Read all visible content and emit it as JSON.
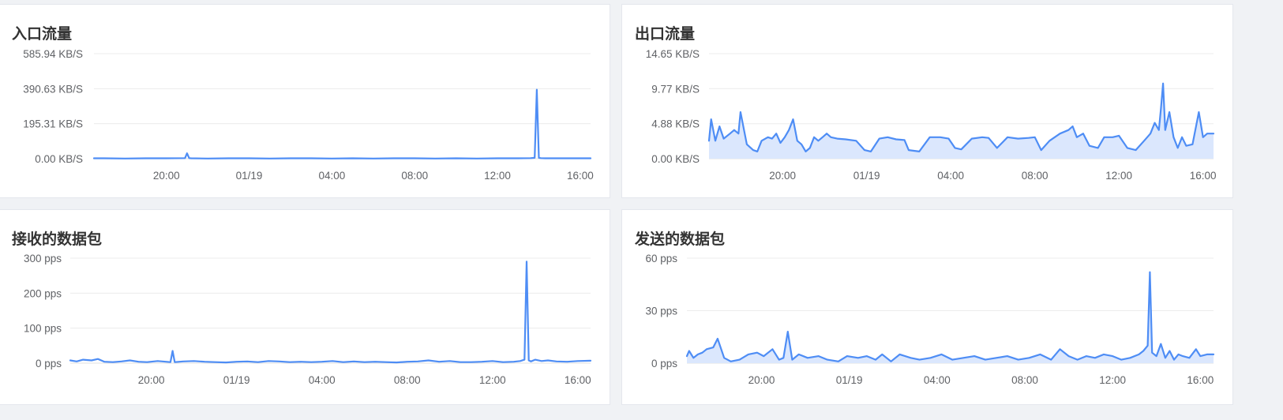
{
  "colors": {
    "line": "#4e8df5",
    "area": "#dbe7fd",
    "grid": "#ececec",
    "text": "#606266"
  },
  "chart_data": [
    {
      "type": "line",
      "title": "入口流量",
      "ylabel": "",
      "xlabel": "",
      "ylim": [
        0,
        585.94
      ],
      "yticks": [
        "585.94 KB/S",
        "390.63 KB/S",
        "195.31 KB/S",
        "0.00 KB/S"
      ],
      "ytick_values": [
        585.94,
        390.63,
        195.31,
        0
      ],
      "xlim_hours": [
        16.5,
        40.5
      ],
      "xticks": [
        "20:00",
        "01/19",
        "04:00",
        "08:00",
        "12:00",
        "16:00"
      ],
      "xtick_hours": [
        20,
        24,
        28,
        32,
        36,
        40
      ],
      "area": false,
      "series": [
        {
          "x": [
            16.5,
            17,
            18,
            19,
            20,
            20.9,
            21.0,
            21.1,
            21.2,
            22,
            23,
            24,
            25,
            26,
            27,
            28,
            29,
            30,
            31,
            32,
            33,
            34,
            35,
            36,
            37,
            37.6,
            37.8,
            37.9,
            38.0,
            38.1,
            38.3,
            39,
            40,
            40.5
          ],
          "y": [
            2,
            2,
            1,
            2,
            2,
            3,
            30,
            3,
            2,
            1,
            2,
            2,
            1,
            2,
            2,
            1,
            2,
            1,
            2,
            2,
            1,
            2,
            1,
            2,
            2,
            3,
            5,
            385,
            5,
            3,
            2,
            2,
            2,
            2
          ]
        }
      ]
    },
    {
      "type": "area",
      "title": "出口流量",
      "ylabel": "",
      "xlabel": "",
      "ylim": [
        0,
        14.65
      ],
      "yticks": [
        "14.65 KB/S",
        "9.77 KB/S",
        "4.88 KB/S",
        "0.00 KB/S"
      ],
      "ytick_values": [
        14.65,
        9.77,
        4.88,
        0
      ],
      "xlim_hours": [
        16.5,
        40.5
      ],
      "xticks": [
        "20:00",
        "01/19",
        "04:00",
        "08:00",
        "12:00",
        "16:00"
      ],
      "xtick_hours": [
        20,
        24,
        28,
        32,
        36,
        40
      ],
      "area": true,
      "series": [
        {
          "x": [
            16.5,
            16.6,
            16.8,
            17.0,
            17.2,
            17.5,
            17.7,
            17.9,
            18.0,
            18.3,
            18.6,
            18.8,
            19.0,
            19.3,
            19.5,
            19.7,
            19.9,
            20.1,
            20.3,
            20.5,
            20.7,
            20.9,
            21.1,
            21.3,
            21.5,
            21.7,
            21.9,
            22.1,
            22.3,
            22.6,
            23,
            23.5,
            23.9,
            24.2,
            24.6,
            25.0,
            25.4,
            25.8,
            26.0,
            26.5,
            27.0,
            27.5,
            27.9,
            28.2,
            28.5,
            29.0,
            29.5,
            29.8,
            30.2,
            30.7,
            31.2,
            31.7,
            32.0,
            32.3,
            32.7,
            33.2,
            33.6,
            33.8,
            34.0,
            34.3,
            34.6,
            35.0,
            35.3,
            35.7,
            36.0,
            36.4,
            36.8,
            37.2,
            37.5,
            37.7,
            37.9,
            38.0,
            38.1,
            38.2,
            38.4,
            38.6,
            38.8,
            39.0,
            39.2,
            39.5,
            39.8,
            40.0,
            40.2,
            40.5
          ],
          "y": [
            2.5,
            5.5,
            2.5,
            4.5,
            2.8,
            3.5,
            4.0,
            3.5,
            6.5,
            2.0,
            1.2,
            1.0,
            2.5,
            3.0,
            2.8,
            3.5,
            2.2,
            3.0,
            4.0,
            5.5,
            2.5,
            2.0,
            1.0,
            1.5,
            3.0,
            2.5,
            3.0,
            3.5,
            3.0,
            2.8,
            2.7,
            2.5,
            1.2,
            1.0,
            2.8,
            3.0,
            2.7,
            2.6,
            1.2,
            1.0,
            3.0,
            3.0,
            2.8,
            1.5,
            1.3,
            2.8,
            3.0,
            2.9,
            1.5,
            3.0,
            2.8,
            2.9,
            3.0,
            1.2,
            2.5,
            3.5,
            4.0,
            4.5,
            3.0,
            3.5,
            1.8,
            1.5,
            3.0,
            3.0,
            3.2,
            1.5,
            1.2,
            2.5,
            3.5,
            5.0,
            4.0,
            7.0,
            10.5,
            4.0,
            6.5,
            3.0,
            1.5,
            3.0,
            1.8,
            2.0,
            6.5,
            3.0,
            3.5,
            3.5
          ]
        }
      ]
    },
    {
      "type": "line",
      "title": "接收的数据包",
      "ylabel": "",
      "xlabel": "",
      "ylim": [
        0,
        300
      ],
      "yticks": [
        "300 pps",
        "200 pps",
        "100 pps",
        "0 pps"
      ],
      "ytick_values": [
        300,
        200,
        100,
        0
      ],
      "xlim_hours": [
        16.2,
        40.6
      ],
      "xticks": [
        "20:00",
        "01/19",
        "04:00",
        "08:00",
        "12:00",
        "16:00"
      ],
      "xtick_hours": [
        20,
        24,
        28,
        32,
        36,
        40
      ],
      "area": false,
      "series": [
        {
          "x": [
            16.2,
            16.5,
            16.8,
            17.2,
            17.5,
            17.8,
            18.2,
            18.6,
            19.0,
            19.4,
            19.8,
            20.3,
            20.9,
            21.0,
            21.1,
            21.5,
            22.0,
            22.5,
            23.0,
            23.5,
            24.0,
            24.5,
            25.0,
            25.5,
            26.0,
            26.5,
            27.0,
            27.5,
            28.0,
            28.5,
            29.0,
            29.5,
            30.0,
            30.5,
            31.0,
            31.5,
            32.0,
            32.5,
            33.0,
            33.5,
            34.0,
            34.5,
            35.0,
            35.5,
            36.0,
            36.5,
            37.0,
            37.3,
            37.5,
            37.6,
            37.7,
            37.8,
            38.0,
            38.3,
            38.6,
            39.0,
            39.5,
            40.0,
            40.6
          ],
          "y": [
            8,
            5,
            10,
            8,
            12,
            4,
            3,
            5,
            8,
            4,
            3,
            6,
            3,
            35,
            3,
            5,
            6,
            4,
            3,
            2,
            4,
            5,
            3,
            6,
            5,
            3,
            4,
            3,
            4,
            6,
            3,
            5,
            3,
            4,
            3,
            2,
            4,
            5,
            8,
            4,
            6,
            3,
            3,
            4,
            6,
            3,
            4,
            6,
            10,
            290,
            8,
            5,
            10,
            6,
            8,
            5,
            4,
            6,
            7
          ]
        }
      ]
    },
    {
      "type": "area",
      "title": "发送的数据包",
      "ylabel": "",
      "xlabel": "",
      "ylim": [
        0,
        60
      ],
      "yticks": [
        "60 pps",
        "30 pps",
        "0 pps"
      ],
      "ytick_values": [
        60,
        30,
        0
      ],
      "xlim_hours": [
        16.6,
        40.6
      ],
      "xticks": [
        "20:00",
        "01/19",
        "04:00",
        "08:00",
        "12:00",
        "16:00"
      ],
      "xtick_hours": [
        20,
        24,
        28,
        32,
        36,
        40
      ],
      "area": true,
      "series": [
        {
          "x": [
            16.6,
            16.7,
            16.9,
            17.1,
            17.3,
            17.5,
            17.8,
            18.0,
            18.3,
            18.6,
            19.0,
            19.4,
            19.8,
            20.1,
            20.5,
            20.8,
            21.0,
            21.2,
            21.4,
            21.7,
            22.1,
            22.6,
            23.0,
            23.5,
            23.9,
            24.4,
            24.8,
            25.2,
            25.5,
            25.9,
            26.3,
            26.8,
            27.2,
            27.7,
            28.2,
            28.7,
            29.2,
            29.7,
            30.2,
            30.7,
            31.2,
            31.7,
            32.2,
            32.7,
            33.2,
            33.6,
            34.0,
            34.4,
            34.8,
            35.2,
            35.6,
            36.0,
            36.4,
            36.8,
            37.2,
            37.4,
            37.6,
            37.7,
            37.8,
            38.0,
            38.2,
            38.4,
            38.6,
            38.8,
            39.0,
            39.2,
            39.5,
            39.8,
            40.0,
            40.3,
            40.6
          ],
          "y": [
            4,
            7,
            3,
            5,
            6,
            8,
            9,
            14,
            3,
            1,
            2,
            5,
            6,
            4,
            8,
            2,
            3,
            18,
            2,
            5,
            3,
            4,
            2,
            1,
            4,
            3,
            4,
            2,
            5,
            1,
            5,
            3,
            2,
            3,
            5,
            2,
            3,
            4,
            2,
            3,
            4,
            2,
            3,
            5,
            2,
            8,
            4,
            2,
            4,
            3,
            5,
            4,
            2,
            3,
            5,
            7,
            10,
            52,
            6,
            4,
            11,
            3,
            7,
            2,
            5,
            4,
            3,
            8,
            4,
            5,
            5
          ]
        }
      ]
    }
  ]
}
